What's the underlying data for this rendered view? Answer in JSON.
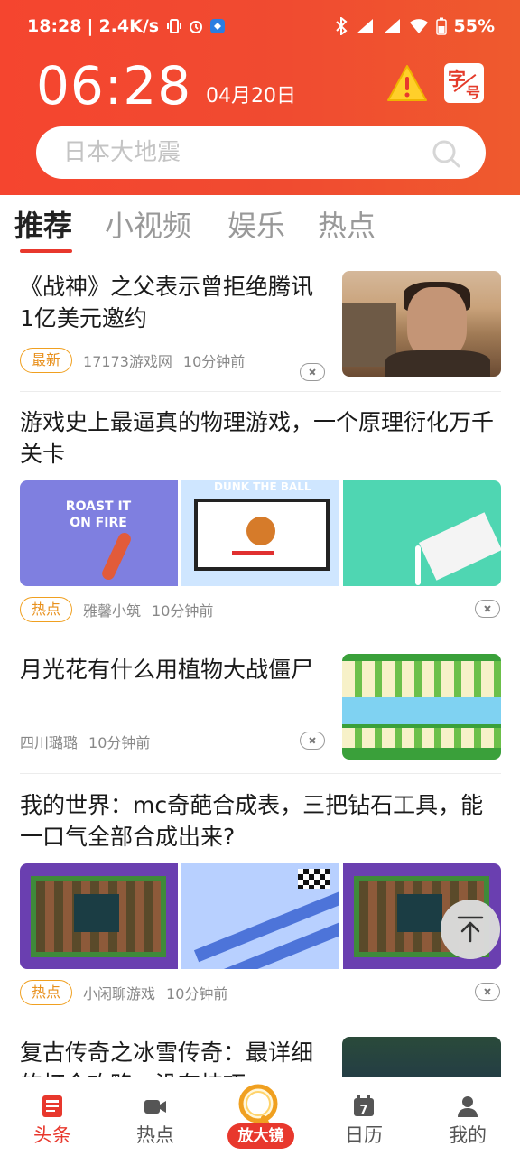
{
  "status_bar": {
    "time": "18:28",
    "net_speed": "2.4K/s",
    "battery": "55%"
  },
  "header": {
    "clock": "06:28",
    "date": "04月20日",
    "font_button_top": "字",
    "font_button_bottom": "号",
    "search_placeholder": "日本大地震"
  },
  "tabs": [
    {
      "label": "推荐",
      "active": true
    },
    {
      "label": "小视频",
      "active": false
    },
    {
      "label": "娱乐",
      "active": false
    },
    {
      "label": "热点",
      "active": false
    }
  ],
  "feed": [
    {
      "title": "《战神》之父表示曾拒绝腾讯1亿美元邀约",
      "badge": "最新",
      "source": "17173游戏网",
      "time": "10分钟前"
    },
    {
      "title": "游戏史上最逼真的物理游戏，一个原理衍化万千关卡",
      "badge": "热点",
      "source": "雅馨小筑",
      "time": "10分钟前",
      "thumb_texts": [
        "ROAST IT ON FIRE",
        "DUNK THE BALL"
      ]
    },
    {
      "title": "月光花有什么用植物大战僵尸",
      "badge": "",
      "source": "四川璐璐",
      "time": "10分钟前"
    },
    {
      "title": "我的世界：mc奇葩合成表，三把钻石工具，能一口气全部合成出来?",
      "badge": "热点",
      "source": "小闲聊游戏",
      "time": "10分钟前"
    },
    {
      "title": "复古传奇之冰雪传奇：最详细的打金攻略，没有技巧",
      "badge": "",
      "source": "",
      "time": ""
    }
  ],
  "bottom_nav": [
    {
      "label": "头条",
      "icon": "news-icon",
      "active": true
    },
    {
      "label": "热点",
      "icon": "video-icon",
      "active": false
    },
    {
      "label": "放大镜",
      "icon": "magnifier-icon",
      "active": false
    },
    {
      "label": "日历",
      "icon": "calendar-icon",
      "active": false,
      "day": "7"
    },
    {
      "label": "我的",
      "icon": "profile-icon",
      "active": false
    }
  ],
  "colors": {
    "brand_red": "#e8382d",
    "badge_orange": "#e8901c"
  }
}
